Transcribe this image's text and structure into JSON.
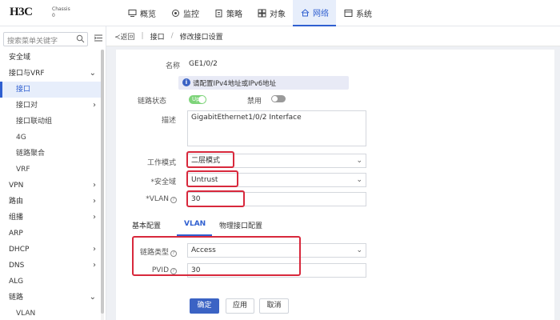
{
  "header": {
    "logo": "H3C",
    "logo_sub_1": "Chassis",
    "logo_sub_2": "0",
    "nav": [
      {
        "label": "概览",
        "icon": "monitor-icon"
      },
      {
        "label": "监控",
        "icon": "target-icon"
      },
      {
        "label": "策略",
        "icon": "clipboard-icon"
      },
      {
        "label": "对象",
        "icon": "grid-icon"
      },
      {
        "label": "网络",
        "icon": "network-icon",
        "active": true
      },
      {
        "label": "系统",
        "icon": "system-icon"
      }
    ]
  },
  "sidebar": {
    "search_placeholder": "搜索菜单关键字",
    "items": [
      {
        "label": "安全域",
        "level": 1
      },
      {
        "label": "接口与VRF",
        "level": 1,
        "arrow": "⌄"
      },
      {
        "label": "接口",
        "level": 2,
        "selected": true
      },
      {
        "label": "接口对",
        "level": 2,
        "arrow": "›"
      },
      {
        "label": "接口联动组",
        "level": 2
      },
      {
        "label": "4G",
        "level": 2
      },
      {
        "label": "链路聚合",
        "level": 2
      },
      {
        "label": "VRF",
        "level": 2
      },
      {
        "label": "VPN",
        "level": 1,
        "arrow": "›"
      },
      {
        "label": "路由",
        "level": 1,
        "arrow": "›"
      },
      {
        "label": "组播",
        "level": 1,
        "arrow": "›"
      },
      {
        "label": "ARP",
        "level": 1
      },
      {
        "label": "DHCP",
        "level": 1,
        "arrow": "›"
      },
      {
        "label": "DNS",
        "level": 1,
        "arrow": "›"
      },
      {
        "label": "ALG",
        "level": 1
      },
      {
        "label": "链路",
        "level": 1,
        "arrow": "⌄"
      },
      {
        "label": "VLAN",
        "level": 2
      }
    ]
  },
  "breadcrumb": {
    "back": "≺返回",
    "sep": "|",
    "item1": "接口",
    "slash": "/",
    "item2": "修改接口设置"
  },
  "form": {
    "name_label": "名称",
    "name_value": "GE1/0/2",
    "tip": "请配置IPv4地址或IPv6地址",
    "link_state_label": "链路状态",
    "toggle_up": "Up",
    "disable_label": "禁用",
    "desc_label": "描述",
    "desc_value": "GigabitEthernet1/0/2 Interface",
    "work_mode_label": "工作模式",
    "work_mode_value": "二层模式",
    "zone_label": "*安全域",
    "zone_value": "Untrust",
    "vlan_label": "*VLAN",
    "vlan_value": "30",
    "help_glyph": "?"
  },
  "tabs": [
    {
      "label": "基本配置"
    },
    {
      "label": "VLAN",
      "active": true
    },
    {
      "label": "物理接口配置"
    }
  ],
  "vlan_tab": {
    "link_type_label": "链路类型",
    "link_type_value": "Access",
    "pvid_label": "PVID",
    "pvid_value": "30"
  },
  "buttons": {
    "ok": "确定",
    "apply": "应用",
    "cancel": "取消"
  },
  "colors": {
    "accent": "#2f5fd0",
    "highlight": "#d8283c",
    "toggle_on": "#7ed47a"
  }
}
